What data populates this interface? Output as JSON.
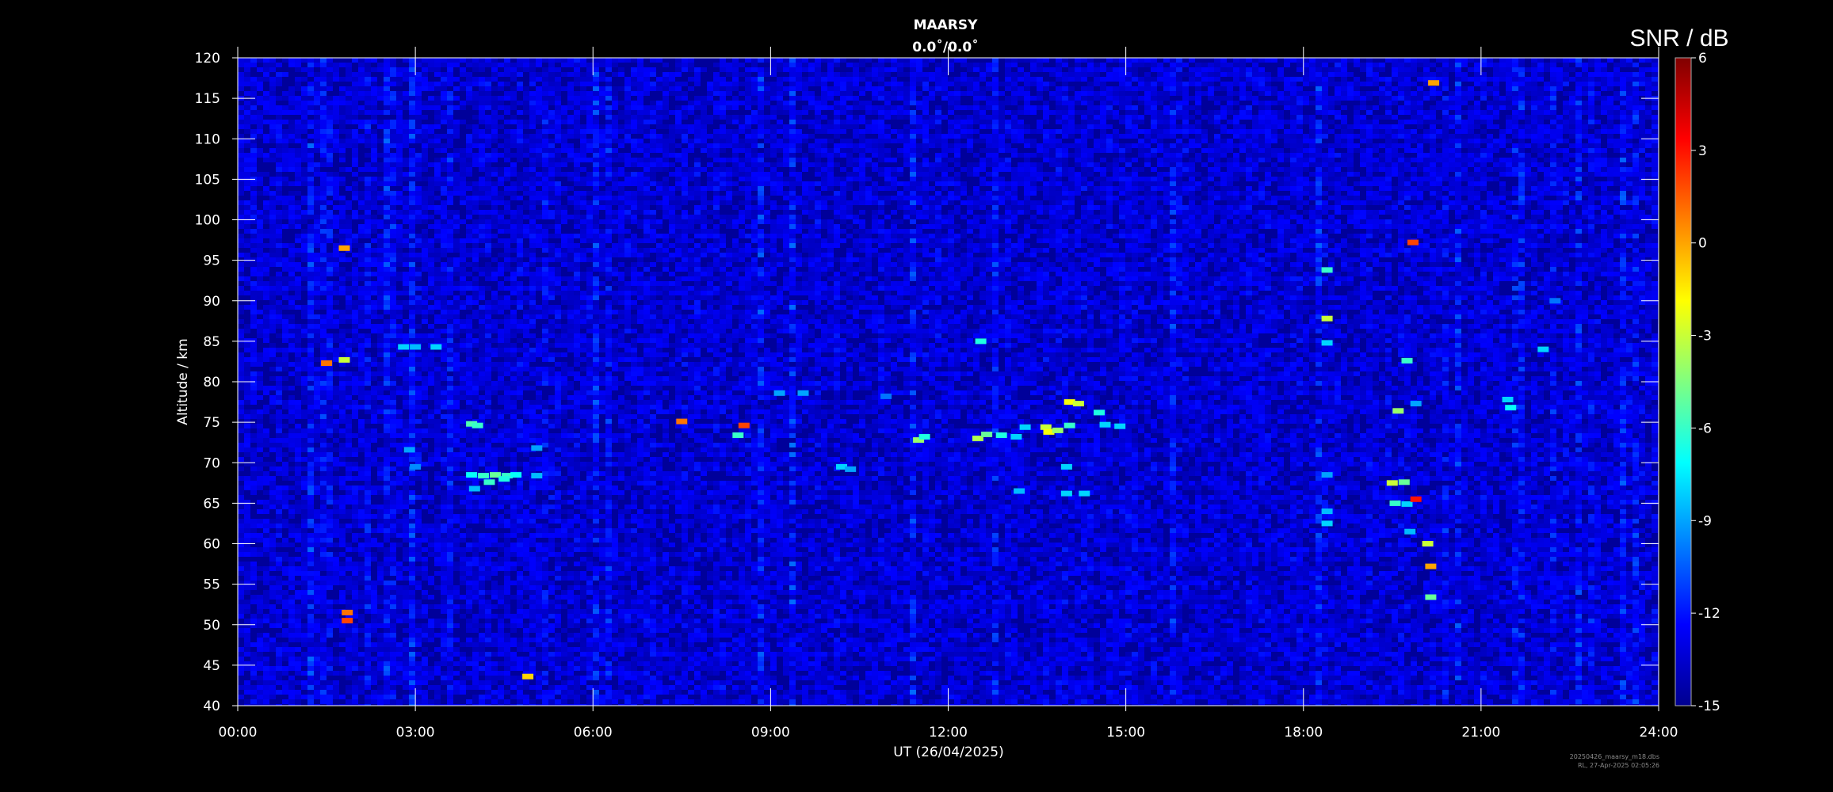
{
  "chart_data": {
    "type": "heatmap",
    "title": "MAARSY",
    "subtitle": "0.0˚/0.0˚",
    "xlabel": "UT (26/04/2025)",
    "ylabel": "Altitude / km",
    "colorbar_label": "SNR / dB",
    "x_range_hours": [
      0,
      24
    ],
    "xticks": [
      "00:00",
      "03:00",
      "06:00",
      "09:00",
      "12:00",
      "15:00",
      "18:00",
      "21:00",
      "24:00"
    ],
    "ylim": [
      40,
      120
    ],
    "yticks": [
      40,
      45,
      50,
      55,
      60,
      65,
      70,
      75,
      80,
      85,
      90,
      95,
      100,
      105,
      110,
      115,
      120
    ],
    "colorbar_range": [
      -15,
      6
    ],
    "colorbar_ticks": [
      -15,
      -12,
      -9,
      -6,
      -3,
      0,
      3,
      6
    ],
    "colormap": [
      "#00008f",
      "#0000ff",
      "#0080ff",
      "#00ffff",
      "#80ff80",
      "#ffff00",
      "#ff8000",
      "#ff0000",
      "#800000"
    ],
    "background_level_db": -13.5,
    "echoes": [
      {
        "t": 1.5,
        "alt": 82.3,
        "snr": 1.0
      },
      {
        "t": 1.8,
        "alt": 96.5,
        "snr": 0.0
      },
      {
        "t": 1.8,
        "alt": 82.7,
        "snr": -3.0
      },
      {
        "t": 1.85,
        "alt": 51.5,
        "snr": 1.0
      },
      {
        "t": 1.85,
        "alt": 50.5,
        "snr": 2.0
      },
      {
        "t": 2.8,
        "alt": 84.3,
        "snr": -8.0
      },
      {
        "t": 3.0,
        "alt": 84.3,
        "snr": -8.5
      },
      {
        "t": 2.9,
        "alt": 71.6,
        "snr": -9.0
      },
      {
        "t": 3.35,
        "alt": 84.3,
        "snr": -8.0
      },
      {
        "t": 3.0,
        "alt": 69.5,
        "snr": -9.5
      },
      {
        "t": 3.95,
        "alt": 74.8,
        "snr": -5.5
      },
      {
        "t": 4.05,
        "alt": 74.6,
        "snr": -6.0
      },
      {
        "t": 3.95,
        "alt": 68.5,
        "snr": -7.0
      },
      {
        "t": 4.15,
        "alt": 68.4,
        "snr": -6.0
      },
      {
        "t": 4.35,
        "alt": 68.5,
        "snr": -5.0
      },
      {
        "t": 4.55,
        "alt": 68.4,
        "snr": -6.0
      },
      {
        "t": 4.7,
        "alt": 68.5,
        "snr": -7.0
      },
      {
        "t": 4.0,
        "alt": 66.8,
        "snr": -8.5
      },
      {
        "t": 4.25,
        "alt": 67.6,
        "snr": -6.0
      },
      {
        "t": 4.5,
        "alt": 68.0,
        "snr": -6.5
      },
      {
        "t": 5.05,
        "alt": 71.8,
        "snr": -9.0
      },
      {
        "t": 5.05,
        "alt": 68.4,
        "snr": -8.5
      },
      {
        "t": 4.9,
        "alt": 43.6,
        "snr": -1.0
      },
      {
        "t": 7.5,
        "alt": 75.1,
        "snr": 1.0
      },
      {
        "t": 8.45,
        "alt": 73.4,
        "snr": -6.0
      },
      {
        "t": 8.55,
        "alt": 74.6,
        "snr": 2.0
      },
      {
        "t": 9.15,
        "alt": 78.6,
        "snr": -9.0
      },
      {
        "t": 9.55,
        "alt": 78.6,
        "snr": -9.0
      },
      {
        "t": 10.2,
        "alt": 69.5,
        "snr": -8.0
      },
      {
        "t": 10.35,
        "alt": 69.2,
        "snr": -9.0
      },
      {
        "t": 10.95,
        "alt": 78.2,
        "snr": -10.0
      },
      {
        "t": 11.5,
        "alt": 72.8,
        "snr": -4.0
      },
      {
        "t": 11.6,
        "alt": 73.2,
        "snr": -6.5
      },
      {
        "t": 12.55,
        "alt": 85.0,
        "snr": -6.5
      },
      {
        "t": 12.5,
        "alt": 73.0,
        "snr": -3.5
      },
      {
        "t": 12.65,
        "alt": 73.5,
        "snr": -5.0
      },
      {
        "t": 12.9,
        "alt": 73.4,
        "snr": -6.5
      },
      {
        "t": 13.15,
        "alt": 73.2,
        "snr": -8.0
      },
      {
        "t": 13.3,
        "alt": 74.4,
        "snr": -8.0
      },
      {
        "t": 13.65,
        "alt": 74.4,
        "snr": -3.0
      },
      {
        "t": 13.7,
        "alt": 73.8,
        "snr": -2.0
      },
      {
        "t": 13.85,
        "alt": 74.0,
        "snr": -4.0
      },
      {
        "t": 14.05,
        "alt": 74.6,
        "snr": -6.0
      },
      {
        "t": 14.05,
        "alt": 77.5,
        "snr": -2.0
      },
      {
        "t": 14.2,
        "alt": 77.3,
        "snr": -3.0
      },
      {
        "t": 13.2,
        "alt": 66.5,
        "snr": -8.5
      },
      {
        "t": 14.0,
        "alt": 69.5,
        "snr": -8.0
      },
      {
        "t": 14.0,
        "alt": 66.2,
        "snr": -8.0
      },
      {
        "t": 14.3,
        "alt": 66.2,
        "snr": -8.0
      },
      {
        "t": 14.55,
        "alt": 76.2,
        "snr": -6.5
      },
      {
        "t": 14.65,
        "alt": 74.7,
        "snr": -8.0
      },
      {
        "t": 14.9,
        "alt": 74.5,
        "snr": -8.0
      },
      {
        "t": 18.4,
        "alt": 93.8,
        "snr": -6.0
      },
      {
        "t": 18.4,
        "alt": 87.8,
        "snr": -3.0
      },
      {
        "t": 18.4,
        "alt": 84.8,
        "snr": -8.0
      },
      {
        "t": 18.4,
        "alt": 64.0,
        "snr": -8.5
      },
      {
        "t": 18.4,
        "alt": 62.5,
        "snr": -8.0
      },
      {
        "t": 18.4,
        "alt": 68.5,
        "snr": -9.0
      },
      {
        "t": 19.6,
        "alt": 76.4,
        "snr": -4.0
      },
      {
        "t": 19.75,
        "alt": 82.6,
        "snr": -6.0
      },
      {
        "t": 19.9,
        "alt": 77.3,
        "snr": -9.0
      },
      {
        "t": 19.5,
        "alt": 67.5,
        "snr": -3.0
      },
      {
        "t": 19.7,
        "alt": 67.6,
        "snr": -5.0
      },
      {
        "t": 19.55,
        "alt": 65.0,
        "snr": -6.0
      },
      {
        "t": 19.75,
        "alt": 64.9,
        "snr": -8.0
      },
      {
        "t": 19.9,
        "alt": 65.5,
        "snr": 3.0
      },
      {
        "t": 19.8,
        "alt": 61.5,
        "snr": -8.5
      },
      {
        "t": 20.2,
        "alt": 116.9,
        "snr": 0.0
      },
      {
        "t": 19.85,
        "alt": 97.2,
        "snr": 2.0
      },
      {
        "t": 20.15,
        "alt": 57.2,
        "snr": 0.0
      },
      {
        "t": 20.15,
        "alt": 53.4,
        "snr": -5.0
      },
      {
        "t": 20.1,
        "alt": 60.0,
        "snr": -3.0
      },
      {
        "t": 21.5,
        "alt": 76.8,
        "snr": -7.0
      },
      {
        "t": 21.45,
        "alt": 77.8,
        "snr": -8.0
      },
      {
        "t": 22.05,
        "alt": 84.0,
        "snr": -8.0
      },
      {
        "t": 22.25,
        "alt": 90.0,
        "snr": -10.0
      }
    ]
  },
  "footer": {
    "line1": "20250426_maarsy_m18.dbs",
    "line2": "RL, 27-Apr-2025 02:05:26"
  }
}
